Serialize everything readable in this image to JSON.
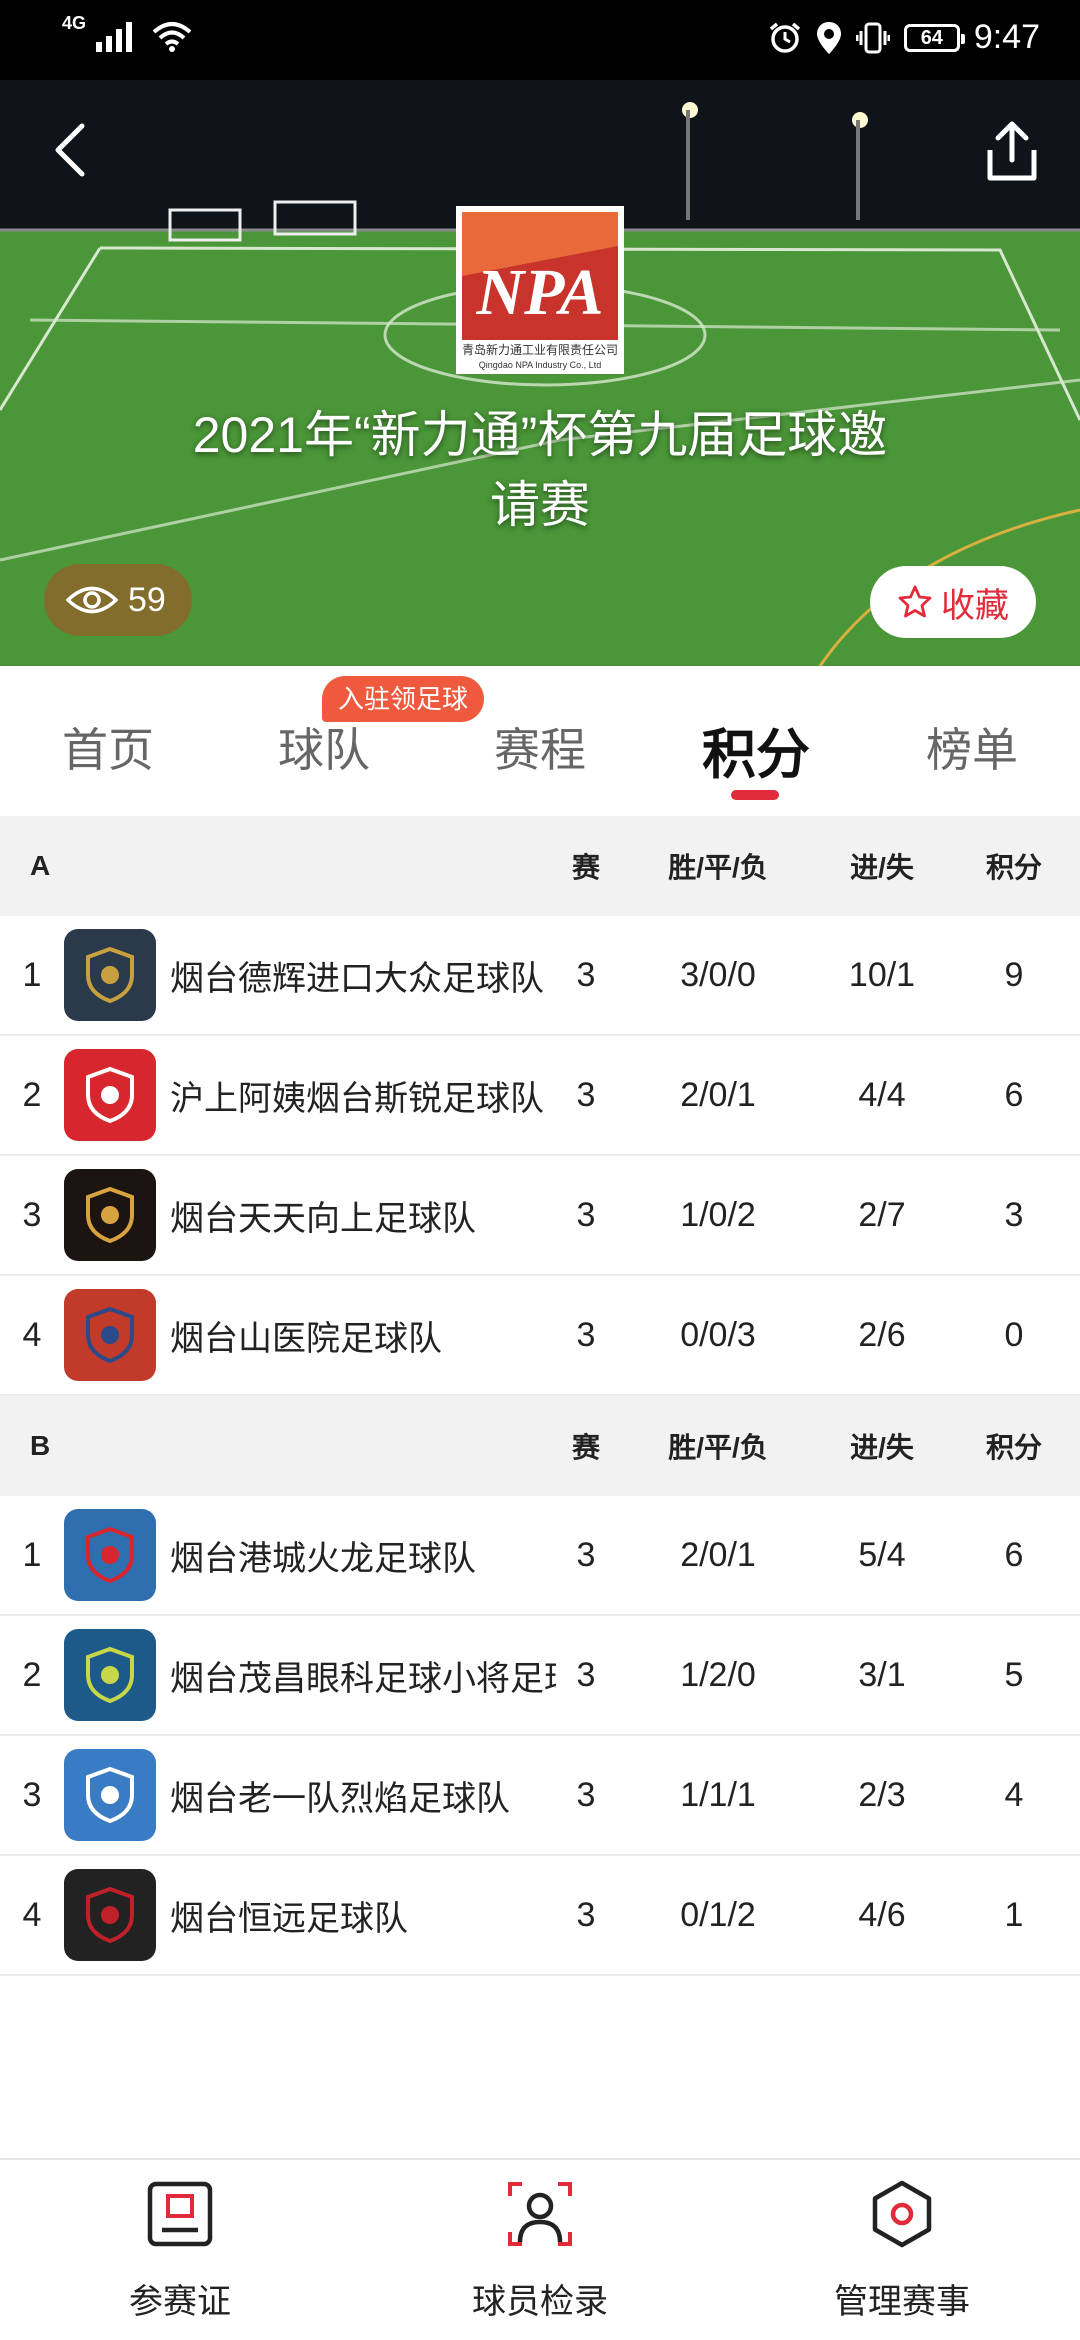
{
  "status_bar": {
    "network": "4G",
    "battery": "64",
    "time": "9:47"
  },
  "hero": {
    "title_line1": "2021年“新力通”杯第九届足球邀",
    "title_line2": "请赛",
    "logo_text": "NPA",
    "logo_caption": "青岛新力通工业有限责任公司",
    "logo_caption_en": "Qingdao NPA Industry Co., Ltd",
    "views": "59",
    "favorite_label": "收藏"
  },
  "tabs": {
    "items": [
      "首页",
      "球队",
      "赛程",
      "积分",
      "榜单"
    ],
    "active": "积分",
    "badge": "入驻领足球"
  },
  "standings": {
    "columns": {
      "played": "赛",
      "wdl": "胜/平/负",
      "goals": "进/失",
      "points": "积分"
    },
    "groups": [
      {
        "name": "A",
        "rows": [
          {
            "rank": "1",
            "team": "烟台德辉进口大众足球队",
            "played": "3",
            "wdl": "3/0/0",
            "goals": "10/1",
            "points": "9",
            "logo_color": "#2b3a4a",
            "logo_accent": "#c8a040"
          },
          {
            "rank": "2",
            "team": "沪上阿姨烟台斯锐足球队",
            "played": "3",
            "wdl": "2/0/1",
            "goals": "4/4",
            "points": "6",
            "logo_color": "#d8262e",
            "logo_accent": "#ffffff"
          },
          {
            "rank": "3",
            "team": "烟台天天向上足球队",
            "played": "3",
            "wdl": "1/0/2",
            "goals": "2/7",
            "points": "3",
            "logo_color": "#1b1410",
            "logo_accent": "#d9a240"
          },
          {
            "rank": "4",
            "team": "烟台山医院足球队",
            "played": "3",
            "wdl": "0/0/3",
            "goals": "2/6",
            "points": "0",
            "logo_color": "#c23a2a",
            "logo_accent": "#2b4a8a"
          }
        ]
      },
      {
        "name": "B",
        "rows": [
          {
            "rank": "1",
            "team": "烟台港城火龙足球队",
            "played": "3",
            "wdl": "2/0/1",
            "goals": "5/4",
            "points": "6",
            "logo_color": "#2f6fb0",
            "logo_accent": "#d8262e"
          },
          {
            "rank": "2",
            "team": "烟台茂昌眼科足球小将足球队",
            "played": "3",
            "wdl": "1/2/0",
            "goals": "3/1",
            "points": "5",
            "logo_color": "#1d5a8a",
            "logo_accent": "#c8d64a"
          },
          {
            "rank": "3",
            "team": "烟台老一队烈焰足球队",
            "played": "3",
            "wdl": "1/1/1",
            "goals": "2/3",
            "points": "4",
            "logo_color": "#3a7cc4",
            "logo_accent": "#ffffff"
          },
          {
            "rank": "4",
            "team": "烟台恒远足球队",
            "played": "3",
            "wdl": "0/1/2",
            "goals": "4/6",
            "points": "1",
            "logo_color": "#222222",
            "logo_accent": "#c0202a"
          }
        ]
      }
    ]
  },
  "bottom_nav": {
    "items": [
      {
        "label": "参赛证",
        "icon": "id-card-icon"
      },
      {
        "label": "球员检录",
        "icon": "face-scan-icon"
      },
      {
        "label": "管理赛事",
        "icon": "hexagon-settings-icon"
      }
    ]
  },
  "colors": {
    "accent": "#e02b3a",
    "badge": "#ef5a3e",
    "header_bg": "#f2f2f2"
  }
}
